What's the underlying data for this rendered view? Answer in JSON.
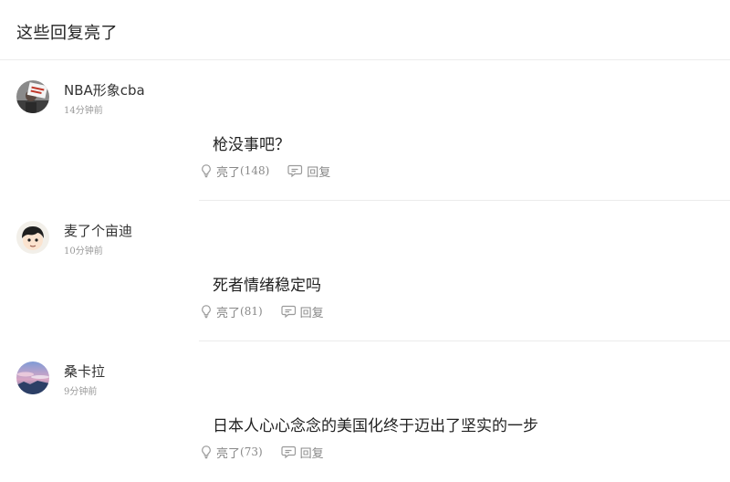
{
  "header": {
    "title": "这些回复亮了"
  },
  "replies": [
    {
      "user": "NBA形象cba",
      "time": "14分钟前",
      "text": "枪没事吧？",
      "like_label": "亮了",
      "like_count": "(148)",
      "reply_label": "回复",
      "avatar_icon": "avatar-protest-sign"
    },
    {
      "user": "麦了个亩迪",
      "time": "10分钟前",
      "text": "死者情绪稳定吗",
      "like_label": "亮了",
      "like_count": "(81)",
      "reply_label": "回复",
      "avatar_icon": "avatar-cartoon-boy"
    },
    {
      "user": "桑卡拉",
      "time": "9分钟前",
      "text": "日本人心心念念的美国化终于迈出了坚实的一步",
      "like_label": "亮了",
      "like_count": "(73)",
      "reply_label": "回复",
      "avatar_icon": "avatar-sky-landscape"
    }
  ],
  "icons": {
    "like": "lightbulb-icon",
    "reply": "chat-bubble-icon"
  },
  "colors": {
    "text": "#222222",
    "muted": "#999999",
    "action": "#888888",
    "divider": "#ececec"
  }
}
